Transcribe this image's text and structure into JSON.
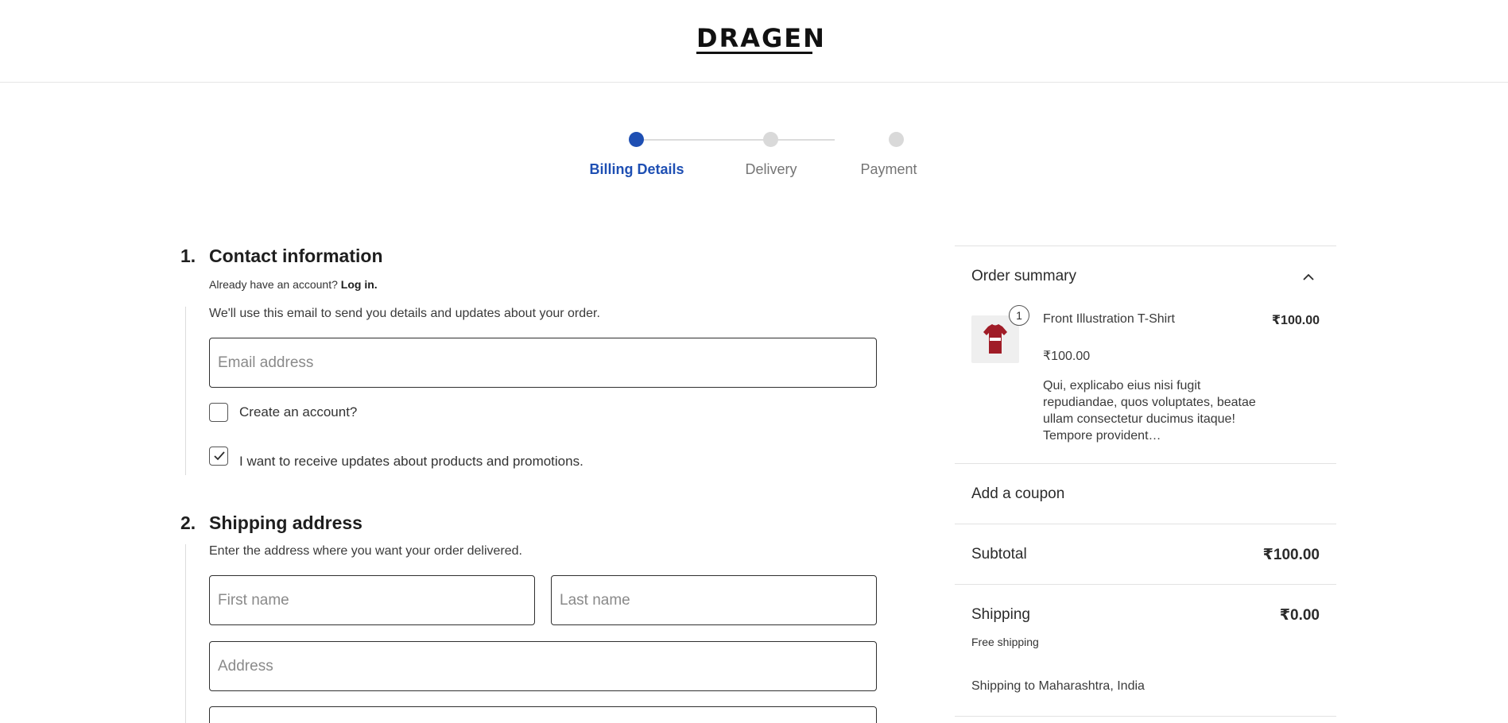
{
  "header": {
    "logo_text": "DRAGEN"
  },
  "stepper": {
    "steps": [
      {
        "label": "Billing Details",
        "active": true
      },
      {
        "label": "Delivery",
        "active": false
      },
      {
        "label": "Payment",
        "active": false
      }
    ]
  },
  "contact": {
    "number": "1.",
    "title": "Contact information",
    "account_prompt": "Already have an account?",
    "login_link": "Log in.",
    "intro": "We'll use this email to send you details and updates about your order.",
    "email_placeholder": "Email address",
    "email_value": "",
    "create_account_label": "Create an account?",
    "create_account_checked": false,
    "updates_label": "I want to receive updates about products and promotions.",
    "updates_checked": true
  },
  "shipping": {
    "number": "2.",
    "title": "Shipping address",
    "intro": "Enter the address where you want your order delivered.",
    "first_name_placeholder": "First name",
    "last_name_placeholder": "Last name",
    "address_placeholder": "Address"
  },
  "summary": {
    "title": "Order summary",
    "item": {
      "quantity": "1",
      "name": "Front Illustration T-Shirt",
      "line_total": "₹100.00",
      "unit_price": "₹100.00",
      "description": "Qui, explicabo eius nisi fugit repudiandae, quos voluptates, beatae ullam consectetur ducimus itaque! Tempore provident…",
      "shirt_print": "DRAGEN",
      "shirt_color": "#a01c27"
    },
    "coupon_label": "Add a coupon",
    "subtotal_label": "Subtotal",
    "subtotal_value": "₹100.00",
    "shipping_label": "Shipping",
    "shipping_value": "₹0.00",
    "shipping_method": "Free shipping",
    "shipping_destination": "Shipping to Maharashtra, India"
  },
  "colors": {
    "accent": "#1e4fb3",
    "inactive_step": "#d9d9d9",
    "text": "#2b2b2b"
  }
}
